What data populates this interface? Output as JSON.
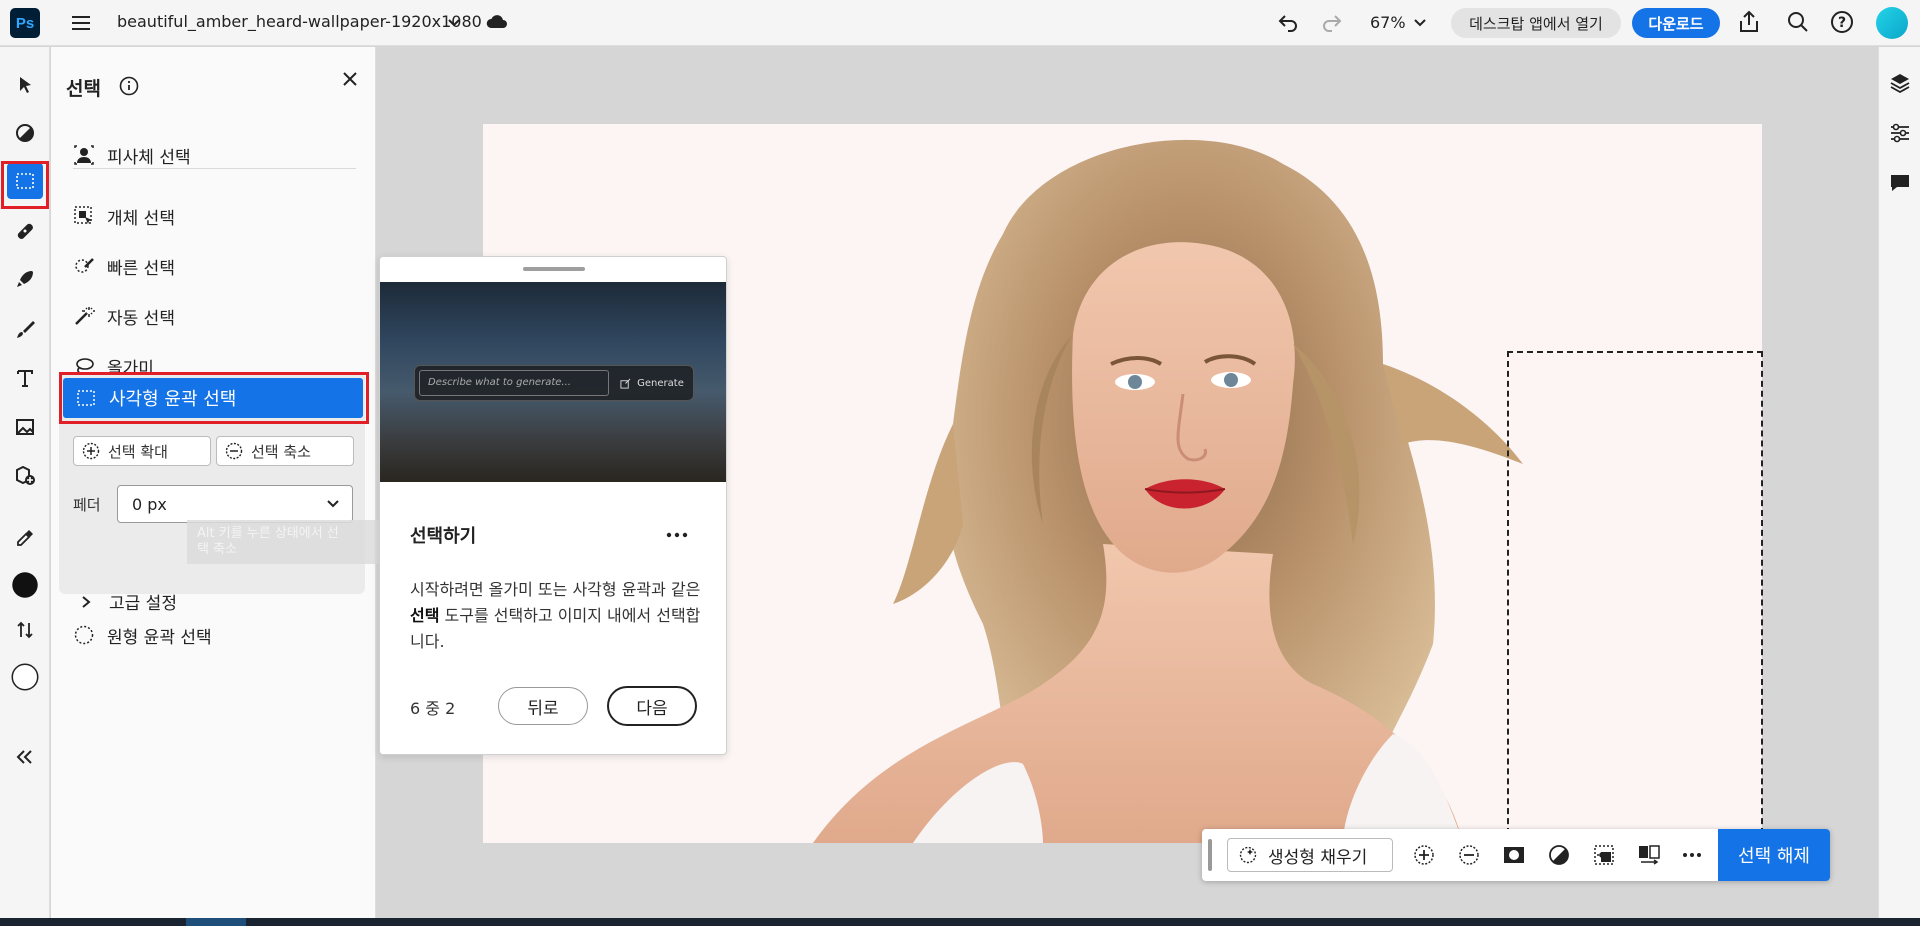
{
  "app": {
    "logo": "Ps",
    "document_title": "beautiful_amber_heard-wallpaper-1920x1080",
    "zoom": "67%",
    "open_desktop_label": "데스크탑 앱에서 열기",
    "download_label": "다운로드"
  },
  "panel": {
    "title": "선택",
    "items": {
      "subject": "피사체 선택",
      "object": "개체 선택",
      "quick": "빠른 선택",
      "magic": "자동 선택",
      "lasso": "올가미",
      "rect_marquee": "사각형 윤곽 선택",
      "elliptical": "원형 윤곽 선택"
    },
    "expand_label": "선택 확대",
    "contract_label": "선택 축소",
    "feather_label": "페더",
    "feather_value": "0 px",
    "tooltip_line1": "Alt 키를 누른 상태에서 선",
    "tooltip_line2": "택 축소",
    "advanced_label": "고급 설정"
  },
  "card": {
    "generate_placeholder": "Describe what to generate...",
    "generate_button": "Generate",
    "title": "선택하기",
    "body_part1": "시작하려면 올가미 또는 사각형 윤곽과 같은 ",
    "body_bold": "선택",
    "body_part2": " 도구를 선택하고 이미지 내에서 선택합니다.",
    "step": "6 중 2",
    "back_label": "뒤로",
    "next_label": "다음"
  },
  "context_bar": {
    "generative_fill_label": "생성형 채우기",
    "deselect_label": "선택 해제"
  },
  "colors": {
    "accent": "#1473e6",
    "highlight": "#e01f26"
  }
}
